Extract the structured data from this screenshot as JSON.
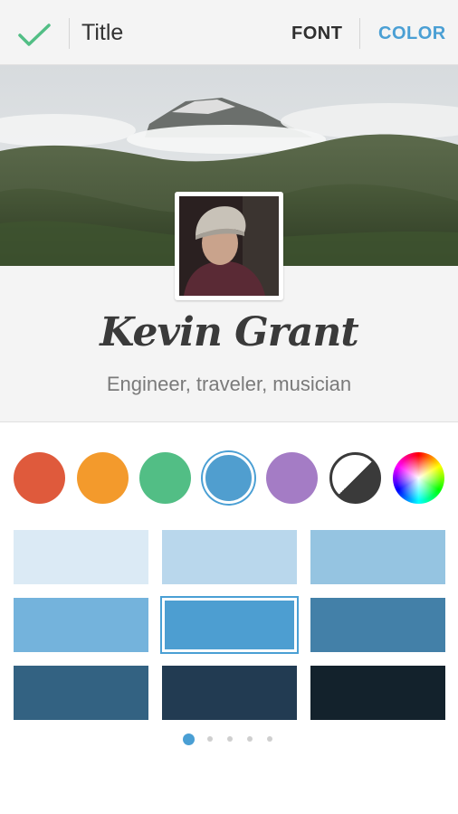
{
  "topbar": {
    "title": "Title",
    "tabs": [
      {
        "label": "FONT",
        "active": false
      },
      {
        "label": "COLOR",
        "active": true
      }
    ],
    "check_icon": "checkmark-icon",
    "accent": "#4a9fd4"
  },
  "profile": {
    "name": "Kevin Grant",
    "bio": "Engineer, traveler, musician",
    "cover_image": "mountain-landscape",
    "avatar_image": "profile-photo"
  },
  "colors": {
    "circles": [
      {
        "name": "red",
        "hex": "#df5a3c"
      },
      {
        "name": "orange",
        "hex": "#f39a2c"
      },
      {
        "name": "green",
        "hex": "#52be85"
      },
      {
        "name": "blue",
        "hex": "#509ecf",
        "selected": true
      },
      {
        "name": "purple",
        "hex": "#a47cc5"
      },
      {
        "name": "black-white",
        "hex": "#3a3a3a"
      },
      {
        "name": "color-wheel",
        "hex": "spectrum"
      }
    ],
    "swatches": [
      [
        "#dbeaf5",
        "#b9d7ec",
        "#95c4e1"
      ],
      [
        "#74b3dc",
        "#4d9ed1",
        "#4380a8"
      ],
      [
        "#336282",
        "#223b52",
        "#13222c"
      ]
    ],
    "selected_swatch": [
      1,
      1
    ]
  },
  "pager": {
    "count": 5,
    "active": 0
  }
}
